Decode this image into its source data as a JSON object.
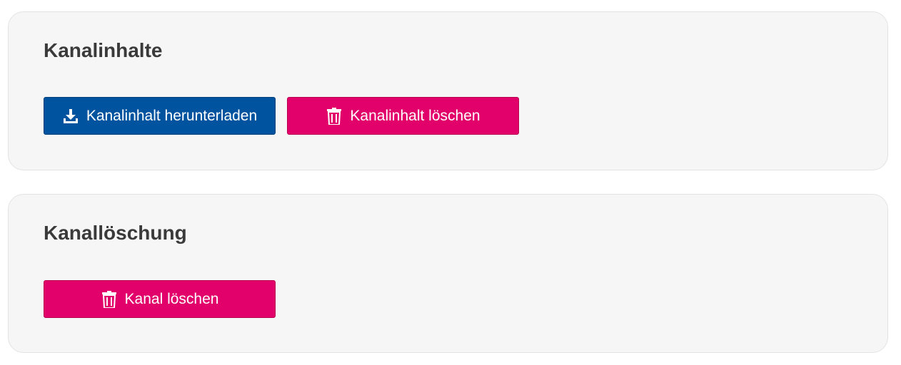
{
  "sections": {
    "content": {
      "title": "Kanalinhalte",
      "download_label": "Kanalinhalt herunterladen",
      "delete_label": "Kanalinhalt löschen"
    },
    "channel_deletion": {
      "title": "Kanallöschung",
      "delete_label": "Kanal löschen"
    }
  },
  "icons": {
    "download": "download-icon",
    "trash": "trash-icon"
  },
  "colors": {
    "primary": "#00549f",
    "danger": "#e2006a",
    "card_background": "#f6f6f6",
    "heading": "#3a3a3a"
  }
}
